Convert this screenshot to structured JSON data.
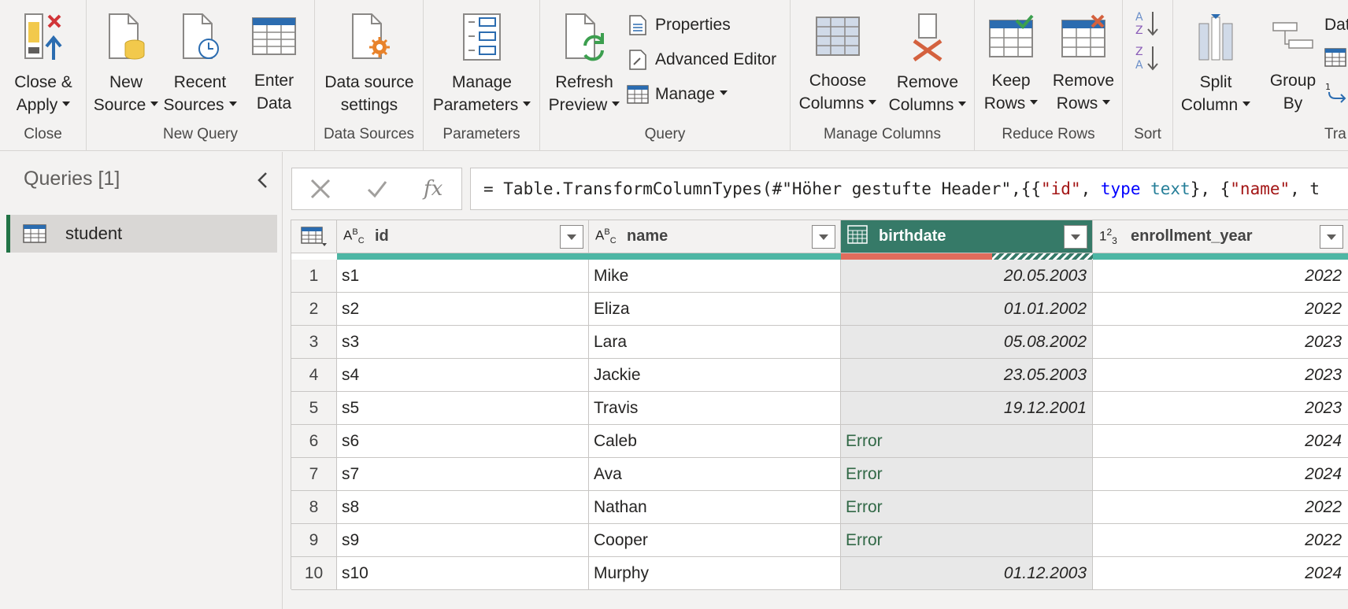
{
  "ribbon": {
    "close": {
      "button_line1": "Close &",
      "button_line2": "Apply",
      "group": "Close"
    },
    "new_query": {
      "new_source_1": "New",
      "new_source_2": "Source",
      "recent_sources_1": "Recent",
      "recent_sources_2": "Sources",
      "enter_data_1": "Enter",
      "enter_data_2": "Data",
      "group": "New Query"
    },
    "data_sources": {
      "settings_1": "Data source",
      "settings_2": "settings",
      "group": "Data Sources"
    },
    "parameters": {
      "manage_1": "Manage",
      "manage_2": "Parameters",
      "group": "Parameters"
    },
    "query": {
      "refresh_1": "Refresh",
      "refresh_2": "Preview",
      "properties": "Properties",
      "advanced_editor": "Advanced Editor",
      "manage": "Manage",
      "group": "Query"
    },
    "manage_columns": {
      "choose_1": "Choose",
      "choose_2": "Columns",
      "remove_1": "Remove",
      "remove_2": "Columns",
      "group": "Manage Columns"
    },
    "reduce_rows": {
      "keep_1": "Keep",
      "keep_2": "Rows",
      "remove_1": "Remove",
      "remove_2": "Rows",
      "group": "Reduce Rows"
    },
    "sort": {
      "group": "Sort"
    },
    "transform": {
      "split_1": "Split",
      "split_2": "Column",
      "group_by_1": "Group",
      "group_by_2": "By",
      "data_type_partial": "Dat",
      "group_partial": "Tra"
    }
  },
  "queries_panel": {
    "title": "Queries [1]",
    "items": [
      {
        "name": "student"
      }
    ]
  },
  "formula_bar": {
    "parts": [
      {
        "t": "= Table.TransformColumnTypes(#\"Höher gestufte Header\",{{",
        "c": ""
      },
      {
        "t": "\"id\"",
        "c": "f-str"
      },
      {
        "t": ", ",
        "c": ""
      },
      {
        "t": "type",
        "c": "f-kw"
      },
      {
        "t": " ",
        "c": ""
      },
      {
        "t": "text",
        "c": "f-ty"
      },
      {
        "t": "}, {",
        "c": ""
      },
      {
        "t": "\"name\"",
        "c": "f-str"
      },
      {
        "t": ", t",
        "c": ""
      }
    ]
  },
  "table": {
    "columns": [
      {
        "name": "id",
        "type_icon": "ABC"
      },
      {
        "name": "name",
        "type_icon": "ABC"
      },
      {
        "name": "birthdate",
        "type_icon": "date"
      },
      {
        "name": "enrollment_year",
        "type_icon": "123"
      }
    ],
    "rows": [
      {
        "n": "1",
        "id": "s1",
        "name": "Mike",
        "birthdate": "20.05.2003",
        "enrollment_year": "2022"
      },
      {
        "n": "2",
        "id": "s2",
        "name": "Eliza",
        "birthdate": "01.01.2002",
        "enrollment_year": "2022"
      },
      {
        "n": "3",
        "id": "s3",
        "name": "Lara",
        "birthdate": "05.08.2002",
        "enrollment_year": "2023"
      },
      {
        "n": "4",
        "id": "s4",
        "name": "Jackie",
        "birthdate": "23.05.2003",
        "enrollment_year": "2023"
      },
      {
        "n": "5",
        "id": "s5",
        "name": "Travis",
        "birthdate": "19.12.2001",
        "enrollment_year": "2023"
      },
      {
        "n": "6",
        "id": "s6",
        "name": "Caleb",
        "birthdate": "Error",
        "enrollment_year": "2024"
      },
      {
        "n": "7",
        "id": "s7",
        "name": "Ava",
        "birthdate": "Error",
        "enrollment_year": "2024"
      },
      {
        "n": "8",
        "id": "s8",
        "name": "Nathan",
        "birthdate": "Error",
        "enrollment_year": "2022"
      },
      {
        "n": "9",
        "id": "s9",
        "name": "Cooper",
        "birthdate": "Error",
        "enrollment_year": "2022"
      },
      {
        "n": "10",
        "id": "s10",
        "name": "Murphy",
        "birthdate": "01.12.2003",
        "enrollment_year": "2024"
      }
    ],
    "birthdate_valid_fraction": 0.4
  },
  "colors": {
    "accent_green": "#217346",
    "selected_header": "#367a68",
    "quality_valid": "#4db6a4",
    "quality_error": "#e06c5c",
    "error_text": "#316846"
  }
}
